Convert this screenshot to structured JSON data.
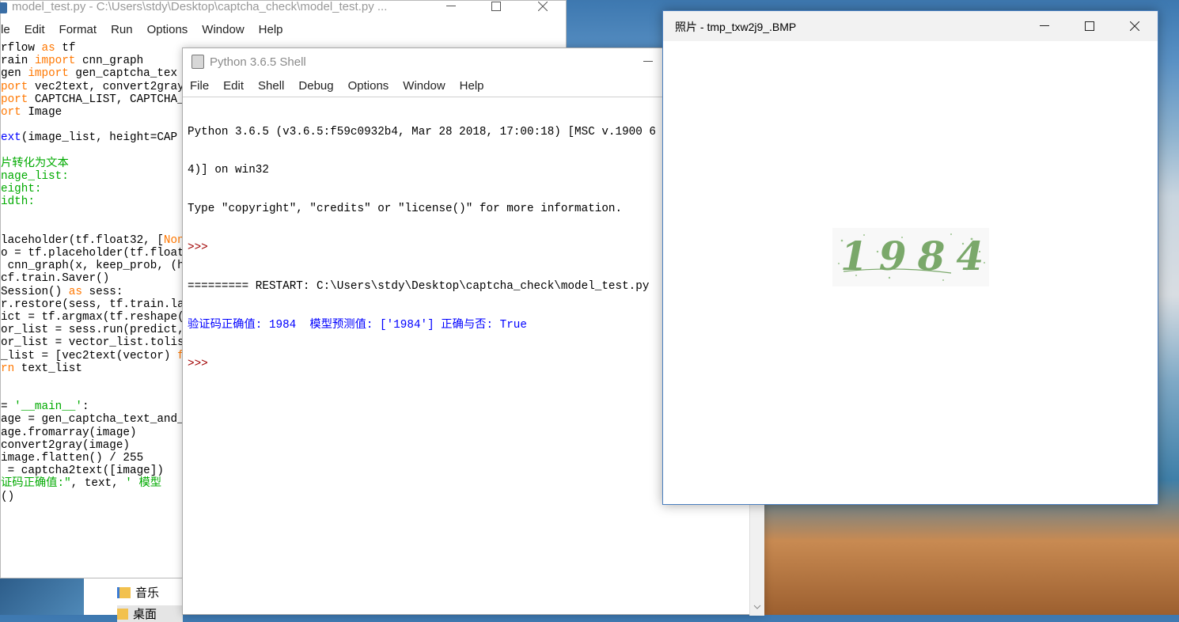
{
  "editor": {
    "title": "model_test.py - C:\\Users\\stdy\\Desktop\\captcha_check\\model_test.py ...",
    "menu": [
      "le",
      "Edit",
      "Format",
      "Run",
      "Options",
      "Window",
      "Help"
    ],
    "lines": [
      [
        {
          "t": "rflow ",
          "c": ""
        },
        {
          "t": "as",
          "c": "kw"
        },
        {
          "t": " tf",
          "c": ""
        }
      ],
      [
        {
          "t": "rain ",
          "c": ""
        },
        {
          "t": "import",
          "c": "kw"
        },
        {
          "t": " cnn_graph",
          "c": ""
        }
      ],
      [
        {
          "t": "gen ",
          "c": ""
        },
        {
          "t": "import",
          "c": "kw"
        },
        {
          "t": " gen_captcha_tex",
          "c": ""
        }
      ],
      [
        {
          "t": "port",
          "c": "kw"
        },
        {
          "t": " vec2text, convert2gray",
          "c": ""
        }
      ],
      [
        {
          "t": "port",
          "c": "kw"
        },
        {
          "t": " CAPTCHA_LIST, CAPTCHA_",
          "c": ""
        }
      ],
      [
        {
          "t": "ort",
          "c": "kw"
        },
        {
          "t": " Image",
          "c": ""
        }
      ],
      [],
      [
        {
          "t": "ext",
          "c": "fn"
        },
        {
          "t": "(image_list, height=CAP",
          "c": ""
        }
      ],
      [],
      [
        {
          "t": "片转化为文本",
          "c": "cm"
        }
      ],
      [
        {
          "t": "nage_list:",
          "c": "cm"
        }
      ],
      [
        {
          "t": "eight:",
          "c": "cm"
        }
      ],
      [
        {
          "t": "idth:",
          "c": "cm"
        }
      ],
      [],
      [],
      [
        {
          "t": "laceholder(tf.float32, [",
          "c": ""
        },
        {
          "t": "Non",
          "c": "kw"
        }
      ],
      [
        {
          "t": "o = tf.placeholder(tf.float",
          "c": ""
        }
      ],
      [
        {
          "t": " cnn_graph(x, keep_prob, (h",
          "c": ""
        }
      ],
      [
        {
          "t": "cf.train.Saver()",
          "c": ""
        }
      ],
      [
        {
          "t": "Session() ",
          "c": ""
        },
        {
          "t": "as",
          "c": "kw"
        },
        {
          "t": " sess:",
          "c": ""
        }
      ],
      [
        {
          "t": "r.restore(sess, tf.train.la",
          "c": ""
        }
      ],
      [
        {
          "t": "ict = tf.argmax(tf.reshape(",
          "c": ""
        }
      ],
      [
        {
          "t": "or_list = sess.run(predict,",
          "c": ""
        }
      ],
      [
        {
          "t": "or_list = vector_list.tolis",
          "c": ""
        }
      ],
      [
        {
          "t": "_list = [vec2text(vector) ",
          "c": ""
        },
        {
          "t": "f",
          "c": "kw"
        }
      ],
      [
        {
          "t": "rn",
          "c": "kw"
        },
        {
          "t": " text_list",
          "c": ""
        }
      ],
      [],
      [],
      [
        {
          "t": "= ",
          "c": ""
        },
        {
          "t": "'__main__'",
          "c": "str"
        },
        {
          "t": ":",
          "c": ""
        }
      ],
      [
        {
          "t": "age = gen_captcha_text_and_",
          "c": ""
        }
      ],
      [
        {
          "t": "age.fromarray(image)",
          "c": ""
        }
      ],
      [
        {
          "t": "convert2gray(image)",
          "c": ""
        }
      ],
      [
        {
          "t": "image.flatten() / 255",
          "c": ""
        }
      ],
      [
        {
          "t": " = captcha2text([image])",
          "c": ""
        }
      ],
      [
        {
          "t": "证码正确值:\"",
          "c": "str"
        },
        {
          "t": ", text, ",
          "c": ""
        },
        {
          "t": "' 模型",
          "c": "str"
        }
      ],
      [
        {
          "t": "()",
          "c": ""
        }
      ]
    ]
  },
  "shell": {
    "title": "Python 3.6.5 Shell",
    "menu": [
      "File",
      "Edit",
      "Shell",
      "Debug",
      "Options",
      "Window",
      "Help"
    ],
    "banner1": "Python 3.6.5 (v3.6.5:f59c0932b4, Mar 28 2018, 17:00:18) [MSC v.1900 6",
    "banner2": "4)] on win32",
    "banner3": "Type \"copyright\", \"credits\" or \"license()\" for more information.",
    "prompt": ">>>",
    "restart": "========= RESTART: C:\\Users\\stdy\\Desktop\\captcha_check\\model_test.py",
    "result": "验证码正确值: 1984  模型预测值: ['1984'] 正确与否: True"
  },
  "photos": {
    "title": "照片 - tmp_txw2j9_.BMP",
    "captcha_text": "1984",
    "captcha_color": "#7aa86a"
  },
  "explorer": {
    "item1": "音乐",
    "item2": "桌面"
  },
  "colors": {
    "keyword": "#ff7700",
    "string": "#00aa00",
    "prompt": "#a00000",
    "output": "#0000ff"
  }
}
